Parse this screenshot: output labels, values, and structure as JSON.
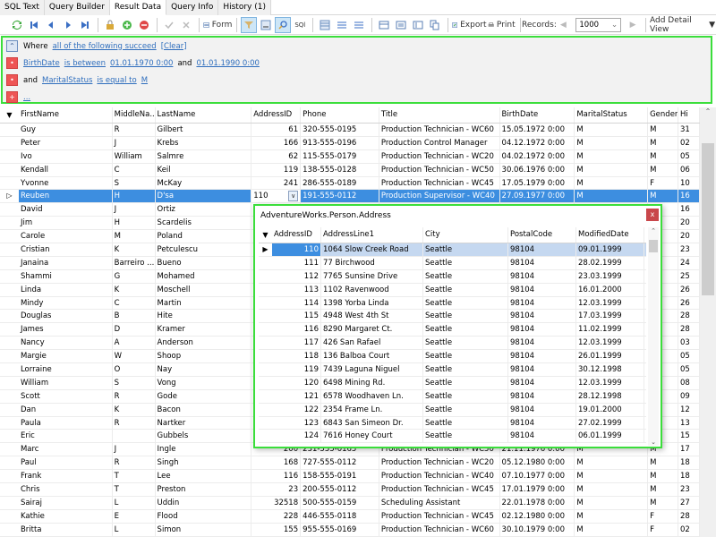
{
  "tabs": [
    "SQL Text",
    "Query Builder",
    "Result Data",
    "Query Info",
    "History (1)"
  ],
  "active_tab": 2,
  "toolbar": {
    "form_label": "Form",
    "sql_label": "SQl",
    "export_label": "Export",
    "print_label": "Print",
    "records_label": "Records:",
    "records_value": "1000",
    "add_detail_view_label": "Add Detail View"
  },
  "filter": {
    "where": "Where",
    "mode_link": "all of the following succeed",
    "clear_link": "[Clear]",
    "cond1": {
      "field": "BirthDate",
      "op": "is between",
      "v1": "01.01.1970 0:00",
      "and": "and",
      "v2": "01.01.1990 0:00"
    },
    "cond2": {
      "prefix": "and",
      "field": "MaritalStatus",
      "op": "is equal to",
      "v1": "M"
    },
    "add_link": "..."
  },
  "grid": {
    "columns": [
      "FirstName",
      "MiddleNa...",
      "LastName",
      "AddressID",
      "Phone",
      "Title",
      "BirthDate",
      "MaritalStatus",
      "Gender",
      "Hi"
    ],
    "rows": [
      [
        "Guy",
        "R",
        "Gilbert",
        "61",
        "320-555-0195",
        "Production Technician - WC60",
        "15.05.1972 0:00",
        "M",
        "M",
        "31"
      ],
      [
        "Peter",
        "J",
        "Krebs",
        "166",
        "913-555-0196",
        "Production Control Manager",
        "04.12.1972 0:00",
        "M",
        "M",
        "02"
      ],
      [
        "Ivo",
        "William",
        "Salmre",
        "62",
        "115-555-0179",
        "Production Technician - WC20",
        "04.02.1972 0:00",
        "M",
        "M",
        "05"
      ],
      [
        "Kendall",
        "C",
        "Keil",
        "119",
        "138-555-0128",
        "Production Technician - WC50",
        "30.06.1976 0:00",
        "M",
        "M",
        "06"
      ],
      [
        "Yvonne",
        "S",
        "McKay",
        "241",
        "286-555-0189",
        "Production Technician - WC45",
        "17.05.1979 0:00",
        "M",
        "F",
        "10"
      ],
      [
        "Reuben",
        "H",
        "D'sa",
        "110",
        "191-555-0112",
        "Production Supervisor - WC40",
        "27.09.1977 0:00",
        "M",
        "M",
        "16"
      ],
      [
        "David",
        "J",
        "Ortiz",
        "",
        "",
        "",
        "",
        "",
        "",
        "16"
      ],
      [
        "Jim",
        "H",
        "Scardelis",
        "",
        "",
        "",
        "",
        "",
        "",
        "20"
      ],
      [
        "Carole",
        "M",
        "Poland",
        "",
        "",
        "",
        "",
        "",
        "",
        "20"
      ],
      [
        "Cristian",
        "K",
        "Petculescu",
        "",
        "",
        "",
        "",
        "",
        "",
        "23"
      ],
      [
        "Janaina",
        "Barreiro ...",
        "Bueno",
        "",
        "",
        "",
        "",
        "",
        "",
        "24"
      ],
      [
        "Shammi",
        "G",
        "Mohamed",
        "",
        "",
        "",
        "",
        "",
        "",
        "25"
      ],
      [
        "Linda",
        "K",
        "Moschell",
        "",
        "",
        "",
        "",
        "",
        "",
        "26"
      ],
      [
        "Mindy",
        "C",
        "Martin",
        "",
        "",
        "",
        "",
        "",
        "",
        "26"
      ],
      [
        "Douglas",
        "B",
        "Hite",
        "",
        "",
        "",
        "",
        "",
        "",
        "28"
      ],
      [
        "James",
        "D",
        "Kramer",
        "",
        "",
        "",
        "",
        "",
        "",
        "28"
      ],
      [
        "Nancy",
        "A",
        "Anderson",
        "",
        "",
        "",
        "",
        "",
        "",
        "03"
      ],
      [
        "Margie",
        "W",
        "Shoop",
        "",
        "",
        "",
        "",
        "",
        "",
        "05"
      ],
      [
        "Lorraine",
        "O",
        "Nay",
        "",
        "",
        "",
        "",
        "",
        "",
        "05"
      ],
      [
        "William",
        "S",
        "Vong",
        "",
        "",
        "",
        "",
        "",
        "",
        "08"
      ],
      [
        "Scott",
        "R",
        "Gode",
        "",
        "",
        "",
        "",
        "",
        "",
        "09"
      ],
      [
        "Dan",
        "K",
        "Bacon",
        "",
        "",
        "",
        "",
        "",
        "",
        "12"
      ],
      [
        "Paula",
        "R",
        "Nartker",
        "",
        "",
        "",
        "",
        "",
        "",
        "13"
      ],
      [
        "Eric",
        "",
        "Gubbels",
        "",
        "",
        "",
        "",
        "",
        "",
        "15"
      ],
      [
        "Marc",
        "J",
        "Ingle",
        "200",
        "231-555-0165",
        "Production Technician - WC50",
        "21.11.1976 0:00",
        "M",
        "M",
        "17"
      ],
      [
        "Paul",
        "R",
        "Singh",
        "168",
        "727-555-0112",
        "Production Technician - WC20",
        "05.12.1980 0:00",
        "M",
        "M",
        "18"
      ],
      [
        "Frank",
        "T",
        "Lee",
        "116",
        "158-555-0191",
        "Production Technician - WC40",
        "07.10.1977 0:00",
        "M",
        "M",
        "18"
      ],
      [
        "Chris",
        "T",
        "Preston",
        "23",
        "200-555-0112",
        "Production Technician - WC45",
        "17.01.1979 0:00",
        "M",
        "M",
        "23"
      ],
      [
        "Sairaj",
        "L",
        "Uddin",
        "32518",
        "500-555-0159",
        "Scheduling Assistant",
        "22.01.1978 0:00",
        "M",
        "M",
        "27"
      ],
      [
        "Kathie",
        "E",
        "Flood",
        "228",
        "446-555-0118",
        "Production Technician - WC45",
        "02.12.1980 0:00",
        "M",
        "F",
        "28"
      ],
      [
        "Britta",
        "L",
        "Simon",
        "155",
        "955-555-0169",
        "Production Technician - WC60",
        "30.10.1979 0:00",
        "M",
        "F",
        "02"
      ]
    ],
    "selected_row": 5,
    "edit_value": "110"
  },
  "popup": {
    "title": "AdventureWorks.Person.Address",
    "close": "x",
    "columns": [
      "AddressID",
      "AddressLine1",
      "City",
      "PostalCode",
      "ModifiedDate"
    ],
    "rows": [
      [
        "110",
        "1064 Slow Creek Road",
        "Seattle",
        "98104",
        "09.01.1999"
      ],
      [
        "111",
        "77 Birchwood",
        "Seattle",
        "98104",
        "28.02.1999"
      ],
      [
        "112",
        "7765 Sunsine Drive",
        "Seattle",
        "98104",
        "23.03.1999"
      ],
      [
        "113",
        "1102 Ravenwood",
        "Seattle",
        "98104",
        "16.01.2000"
      ],
      [
        "114",
        "1398 Yorba Linda",
        "Seattle",
        "98104",
        "12.03.1999"
      ],
      [
        "115",
        "4948 West 4th St",
        "Seattle",
        "98104",
        "17.03.1999"
      ],
      [
        "116",
        "8290 Margaret Ct.",
        "Seattle",
        "98104",
        "11.02.1999"
      ],
      [
        "117",
        "426 San Rafael",
        "Seattle",
        "98104",
        "12.03.1999"
      ],
      [
        "118",
        "136 Balboa Court",
        "Seattle",
        "98104",
        "26.01.1999"
      ],
      [
        "119",
        "7439 Laguna Niguel",
        "Seattle",
        "98104",
        "30.12.1998"
      ],
      [
        "120",
        "6498 Mining Rd.",
        "Seattle",
        "98104",
        "12.03.1999"
      ],
      [
        "121",
        "6578 Woodhaven Ln.",
        "Seattle",
        "98104",
        "28.12.1998"
      ],
      [
        "122",
        "2354 Frame Ln.",
        "Seattle",
        "98104",
        "19.01.2000"
      ],
      [
        "123",
        "6843 San Simeon Dr.",
        "Seattle",
        "98104",
        "27.02.1999"
      ],
      [
        "124",
        "7616 Honey Court",
        "Seattle",
        "98104",
        "06.01.1999"
      ]
    ],
    "selected_row": 0
  }
}
